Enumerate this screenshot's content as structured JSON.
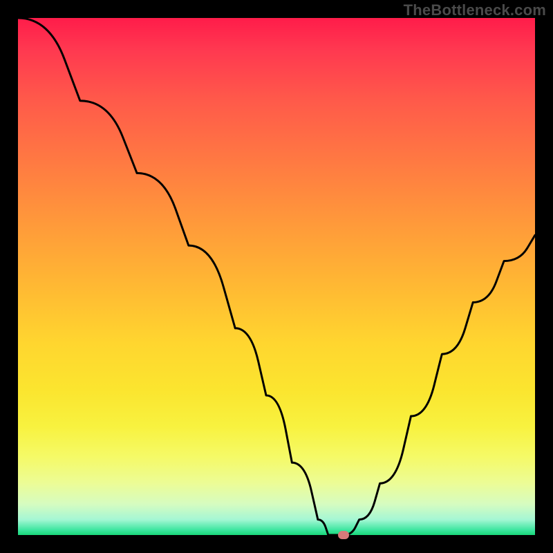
{
  "watermark": "TheBottleneck.com",
  "colors": {
    "frame": "#000000",
    "curve": "#000000",
    "marker": "#d97a7a",
    "watermark_text": "#4a4a4a",
    "gradient_top": "#ff1c4a",
    "gradient_bottom": "#18d779"
  },
  "chart_data": {
    "type": "line",
    "title": "",
    "xlabel": "",
    "ylabel": "",
    "xlim": [
      0,
      100
    ],
    "ylim": [
      0,
      100
    ],
    "grid": false,
    "series": [
      {
        "name": "bottleneck-curve",
        "x": [
          0,
          12,
          23,
          33,
          42,
          48,
          53,
          58,
          60,
          63,
          66,
          70,
          76,
          82,
          88,
          94,
          100
        ],
        "values": [
          100,
          84,
          70,
          56,
          40,
          27,
          14,
          3,
          0,
          0,
          3,
          10,
          23,
          35,
          45,
          53,
          58
        ]
      }
    ],
    "marker": {
      "x": 63,
      "y": 0,
      "label": ""
    },
    "annotations": []
  }
}
